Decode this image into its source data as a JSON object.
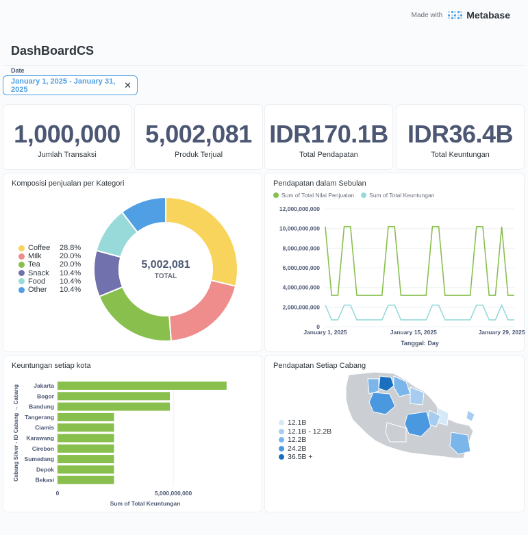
{
  "brand": {
    "made_with": "Made with",
    "name": "Metabase"
  },
  "dashboard": {
    "title": "DashBoardCS"
  },
  "filter": {
    "label": "Date",
    "value": "January 1, 2025 - January 31, 2025",
    "clear_icon": "close-icon"
  },
  "kpis": [
    {
      "value": "1,000,000",
      "label": "Jumlah Transaksi"
    },
    {
      "value": "5,002,081",
      "label": "Produk Terjual"
    },
    {
      "value": "IDR170.1B",
      "label": "Total Pendapatan"
    },
    {
      "value": "IDR36.4B",
      "label": "Total Keuntungan"
    }
  ],
  "donut": {
    "title": "Komposisi penjualan per Kategori",
    "center_value": "5,002,081",
    "center_label": "TOTAL",
    "legend": [
      {
        "name": "Coffee",
        "pct": "28.8%",
        "color": "#f9d45c"
      },
      {
        "name": "Milk",
        "pct": "20.0%",
        "color": "#ef8c8c"
      },
      {
        "name": "Tea",
        "pct": "20.0%",
        "color": "#88bf4d"
      },
      {
        "name": "Snack",
        "pct": "10.4%",
        "color": "#7172ad"
      },
      {
        "name": "Food",
        "pct": "10.4%",
        "color": "#98d9d9"
      },
      {
        "name": "Other",
        "pct": "10.4%",
        "color": "#509ee3"
      }
    ]
  },
  "line_chart": {
    "title": "Pendapatan dalam Sebulan",
    "legend": [
      "Sum of Total Nilai Penjualan",
      "Sum of Total Keuntungan"
    ],
    "xlabel": "Tanggal: Day",
    "x_ticks": [
      "January 1, 2025",
      "January 15, 2025",
      "January 29, 2025"
    ],
    "y_ticks": [
      "0",
      "2,000,000,000",
      "4,000,000,000",
      "6,000,000,000",
      "8,000,000,000",
      "10,000,000,000",
      "12,000,000,000"
    ]
  },
  "bar_chart": {
    "title": "Keuntungan setiap kota",
    "ylabel": "Cabang Silver - ID Cabang → Cabang",
    "xlabel": "Sum of Total Keuntungan",
    "x_ticks": [
      "0",
      "5,000,000,000"
    ]
  },
  "map": {
    "title": "Pendapatan Setiap Cabang",
    "legend": [
      {
        "label": "12.1B",
        "color": "#d6e9f8"
      },
      {
        "label": "12.1B - 12.2B",
        "color": "#a6cdf0"
      },
      {
        "label": "12.2B",
        "color": "#7ab6ea"
      },
      {
        "label": "24.2B",
        "color": "#4a98e0"
      },
      {
        "label": "36.5B +",
        "color": "#1a6fbf"
      }
    ]
  },
  "chart_data": [
    {
      "type": "pie",
      "title": "Komposisi penjualan per Kategori",
      "categories": [
        "Coffee",
        "Milk",
        "Tea",
        "Snack",
        "Food",
        "Other"
      ],
      "values": [
        28.8,
        20.0,
        20.0,
        10.4,
        10.4,
        10.4
      ],
      "total": 5002081
    },
    {
      "type": "line",
      "title": "Pendapatan dalam Sebulan",
      "xlabel": "Tanggal: Day",
      "x": [
        "2025-01-01",
        "2025-01-02",
        "2025-01-03",
        "2025-01-04",
        "2025-01-05",
        "2025-01-06",
        "2025-01-07",
        "2025-01-08",
        "2025-01-09",
        "2025-01-10",
        "2025-01-11",
        "2025-01-12",
        "2025-01-13",
        "2025-01-14",
        "2025-01-15",
        "2025-01-16",
        "2025-01-17",
        "2025-01-18",
        "2025-01-19",
        "2025-01-20",
        "2025-01-21",
        "2025-01-22",
        "2025-01-23",
        "2025-01-24",
        "2025-01-25",
        "2025-01-26",
        "2025-01-27",
        "2025-01-28",
        "2025-01-29",
        "2025-01-30",
        "2025-01-31"
      ],
      "ylim": [
        0,
        12000000000
      ],
      "series": [
        {
          "name": "Sum of Total Nilai Penjualan",
          "color": "#88bf4d",
          "values": [
            10200000000,
            3200000000,
            3200000000,
            10200000000,
            10200000000,
            3200000000,
            3200000000,
            3200000000,
            3200000000,
            3200000000,
            10200000000,
            10200000000,
            3200000000,
            3200000000,
            3200000000,
            3200000000,
            3200000000,
            10200000000,
            10200000000,
            3200000000,
            3200000000,
            3200000000,
            3200000000,
            3200000000,
            10200000000,
            10200000000,
            3200000000,
            3200000000,
            10200000000,
            3200000000,
            3200000000
          ]
        },
        {
          "name": "Sum of Total Keuntungan",
          "color": "#98d9d9",
          "values": [
            2200000000,
            700000000,
            700000000,
            2200000000,
            2200000000,
            700000000,
            700000000,
            700000000,
            700000000,
            700000000,
            2200000000,
            2200000000,
            700000000,
            700000000,
            700000000,
            700000000,
            700000000,
            2200000000,
            2200000000,
            700000000,
            700000000,
            700000000,
            700000000,
            700000000,
            2200000000,
            2200000000,
            700000000,
            700000000,
            2200000000,
            700000000,
            700000000
          ]
        }
      ]
    },
    {
      "type": "bar",
      "orientation": "horizontal",
      "title": "Keuntungan setiap kota",
      "xlabel": "Sum of Total Keuntungan",
      "ylabel": "Cabang Silver - ID Cabang → Cabang",
      "categories": [
        "Jakarta",
        "Bogor",
        "Bandung",
        "Tangerang",
        "Ciamis",
        "Karawang",
        "Cirebon",
        "Sumedang",
        "Depok",
        "Bekasi"
      ],
      "values": [
        7300000000,
        4850000000,
        4850000000,
        2440000000,
        2440000000,
        2440000000,
        2440000000,
        2440000000,
        2440000000,
        2440000000
      ],
      "xlim": [
        0,
        7600000000
      ],
      "color": "#88bf4d"
    }
  ]
}
